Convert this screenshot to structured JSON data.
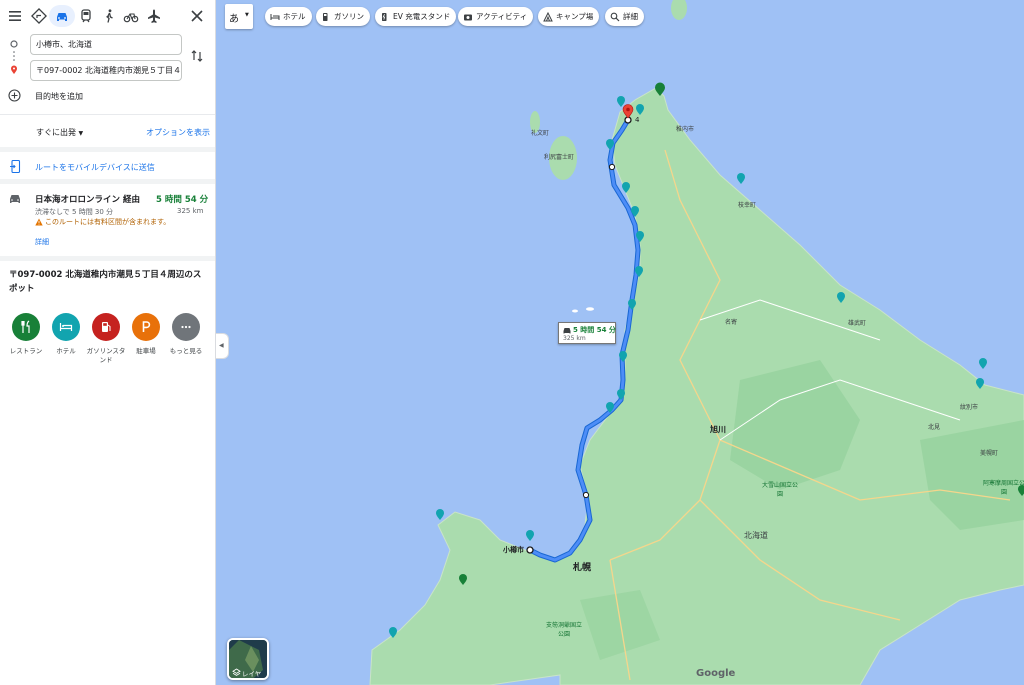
{
  "travel_modes": {
    "menu": "menu-icon",
    "best": "directions-icon",
    "car": "car-icon",
    "transit": "train-icon",
    "walk": "walk-icon",
    "bike": "bike-icon",
    "flight": "plane-icon",
    "close": "close-icon"
  },
  "directions": {
    "origin": "小樽市、北海道",
    "destination": "〒097-0002 北海道稚内市潮見５丁目４",
    "add_destination": "目的地を追加",
    "depart": "すぐに出発",
    "options": "オプションを表示",
    "send_to_mobile": "ルートをモバイルデバイスに送信"
  },
  "route": {
    "name": "日本海オロロンライン 経由",
    "duration": "5 時間 54 分",
    "traffic_note": "渋滞なしで 5 時間 30 分",
    "distance": "325 km",
    "warning": "このルートには有料区間が含まれます。",
    "details_link": "詳細"
  },
  "nearby": {
    "title": "〒097-0002 北海道稚内市潮見５丁目４周辺のスポット",
    "categories": [
      {
        "label": "レストラン",
        "icon": "restaurant-icon",
        "color": "#188038"
      },
      {
        "label": "ホテル",
        "icon": "hotel-icon",
        "color": "#12a4af"
      },
      {
        "label": "ガソリンスタンド",
        "icon": "gas-station-icon",
        "color": "#c5221f"
      },
      {
        "label": "駐車場",
        "icon": "parking-icon",
        "color": "#e8710a"
      },
      {
        "label": "もっと見る",
        "icon": "more-icon",
        "color": "#70757a"
      }
    ]
  },
  "map": {
    "lang_button": "あ",
    "chips": [
      {
        "label": "ホテル",
        "icon": "hotel-icon"
      },
      {
        "label": "ガソリン",
        "icon": "gas-icon"
      },
      {
        "label": "EV 充電スタンド",
        "icon": "ev-charger-icon"
      },
      {
        "label": "アクティビティ",
        "icon": "camera-icon"
      },
      {
        "label": "キャンプ場",
        "icon": "camp-icon"
      },
      {
        "label": "詳細",
        "icon": "search-icon"
      }
    ],
    "route_label_duration": "5 時間 54 分",
    "route_label_distance": "325 km",
    "labels": {
      "otaru": "小樽市",
      "sapporo": "札幌",
      "asahikawa": "旭川",
      "hokkaido": "北海道",
      "daisetsuzan": "大雪山国立公園",
      "akan": "阿寒摩周国立公園",
      "shikotsu": "支笏洞爺国立公園",
      "rishiri": "利尻富士町",
      "rebun": "礼文町",
      "wakkanai": "稚内市",
      "omu": "雄武町",
      "esashi": "枝幸町",
      "monbetsu": "紋別市",
      "kitami": "北見",
      "nayoro": "名寄",
      "bihoro": "美幌町",
      "google": "Google",
      "dest_num": "4"
    },
    "layers_label": "レイヤ",
    "colors": {
      "route": "#1a73e8",
      "land": "#aadcae",
      "water": "#9fc1f5",
      "text_green": "#188038"
    }
  }
}
